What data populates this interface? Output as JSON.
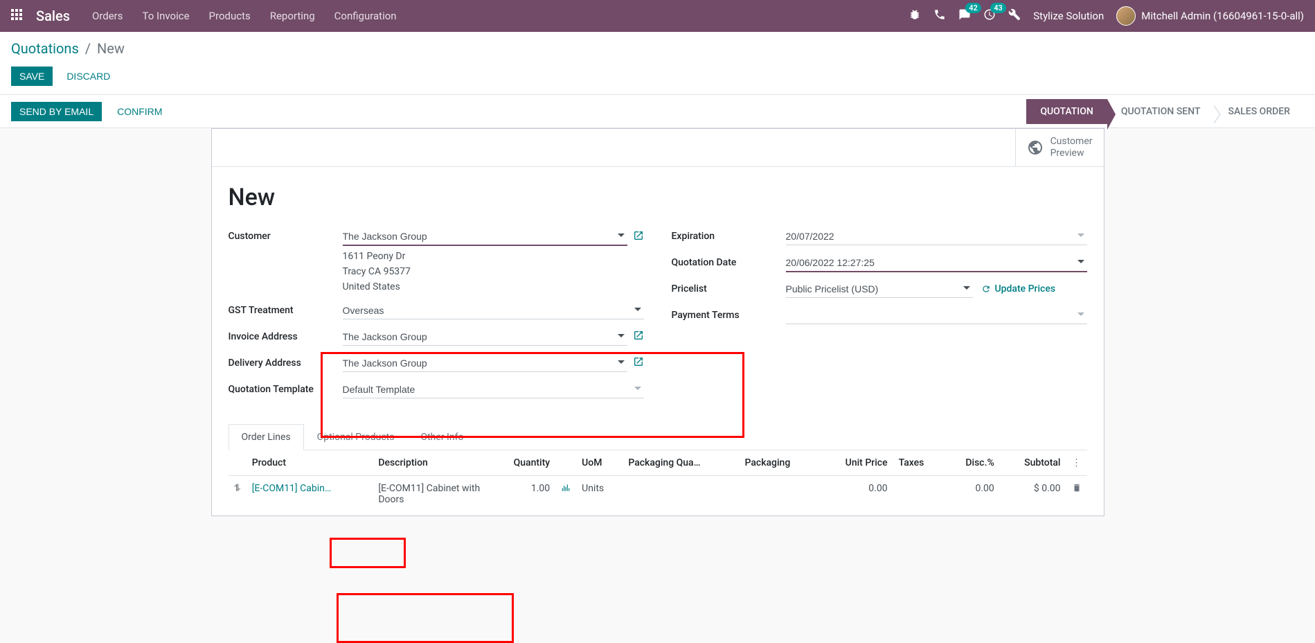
{
  "topnav": {
    "brand": "Sales",
    "menu": [
      "Orders",
      "To Invoice",
      "Products",
      "Reporting",
      "Configuration"
    ],
    "msg_count": "42",
    "activity_count": "43",
    "company": "Stylize Solution",
    "user": "Mitchell Admin (16604961-15-0-all)"
  },
  "breadcrumb": {
    "root": "Quotations",
    "current": "New"
  },
  "buttons": {
    "save": "SAVE",
    "discard": "DISCARD",
    "send": "SEND BY EMAIL",
    "confirm": "CONFIRM"
  },
  "status": {
    "s1": "QUOTATION",
    "s2": "QUOTATION SENT",
    "s3": "SALES ORDER"
  },
  "statbtn": {
    "line1": "Customer",
    "line2": "Preview"
  },
  "title": "New",
  "form": {
    "customer_label": "Customer",
    "customer": "The Jackson Group",
    "addr1": "1611 Peony Dr",
    "addr2": "Tracy CA 95377",
    "addr3": "United States",
    "gst_label": "GST Treatment",
    "gst": "Overseas",
    "invoice_label": "Invoice Address",
    "invoice": "The Jackson Group",
    "delivery_label": "Delivery Address",
    "delivery": "The Jackson Group",
    "template_label": "Quotation Template",
    "template": "Default Template",
    "exp_label": "Expiration",
    "exp": "20/07/2022",
    "qdate_label": "Quotation Date",
    "qdate": "20/06/2022 12:27:25",
    "pricelist_label": "Pricelist",
    "pricelist": "Public Pricelist (USD)",
    "update": "Update Prices",
    "terms_label": "Payment Terms",
    "terms": ""
  },
  "tabs": {
    "t1": "Order Lines",
    "t2": "Optional Products",
    "t3": "Other Info"
  },
  "table": {
    "h_product": "Product",
    "h_desc": "Description",
    "h_qty": "Quantity",
    "h_uom": "UoM",
    "h_pkgqty": "Packaging Qua…",
    "h_pkg": "Packaging",
    "h_price": "Unit Price",
    "h_tax": "Taxes",
    "h_disc": "Disc.%",
    "h_sub": "Subtotal",
    "r1_product": "[E-COM11] Cabin…",
    "r1_desc": "[E-COM11] Cabinet with Doors",
    "r1_qty": "1.00",
    "r1_uom": "Units",
    "r1_price": "0.00",
    "r1_disc": "0.00",
    "r1_sub": "$ 0.00"
  }
}
